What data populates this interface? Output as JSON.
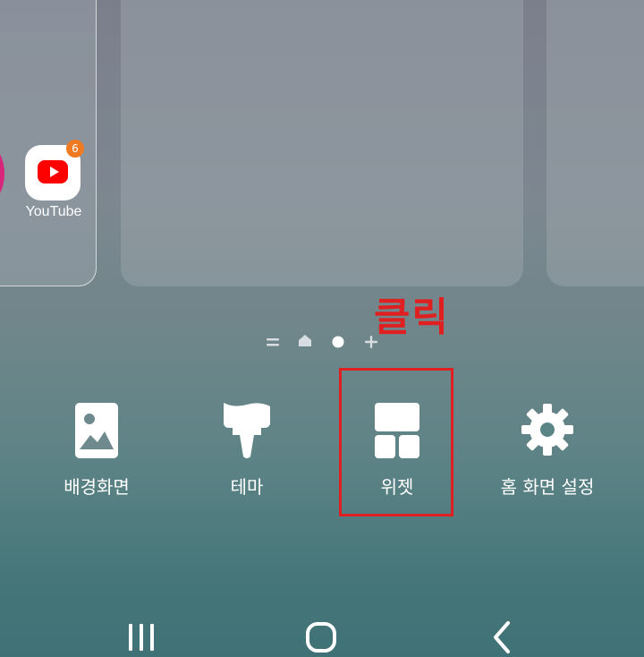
{
  "home_preview": {
    "app": {
      "label": "YouTube",
      "badge_count": "6",
      "icon": "youtube-icon"
    }
  },
  "annotation": {
    "text": "클릭",
    "color": "#e02020"
  },
  "page_indicators": [
    {
      "icon": "page-list-icon"
    },
    {
      "icon": "home-page-icon"
    },
    {
      "icon": "current-page-dot-icon"
    },
    {
      "icon": "add-page-icon"
    }
  ],
  "options": {
    "wallpaper": {
      "label": "배경화면",
      "icon": "wallpaper-icon"
    },
    "theme": {
      "label": "테마",
      "icon": "brush-icon"
    },
    "widget": {
      "label": "위젯",
      "icon": "widget-icon"
    },
    "settings": {
      "label": "홈 화면 설정",
      "icon": "gear-icon"
    }
  },
  "navigation": {
    "recents": "recents-icon",
    "home": "home-icon",
    "back": "back-icon"
  }
}
